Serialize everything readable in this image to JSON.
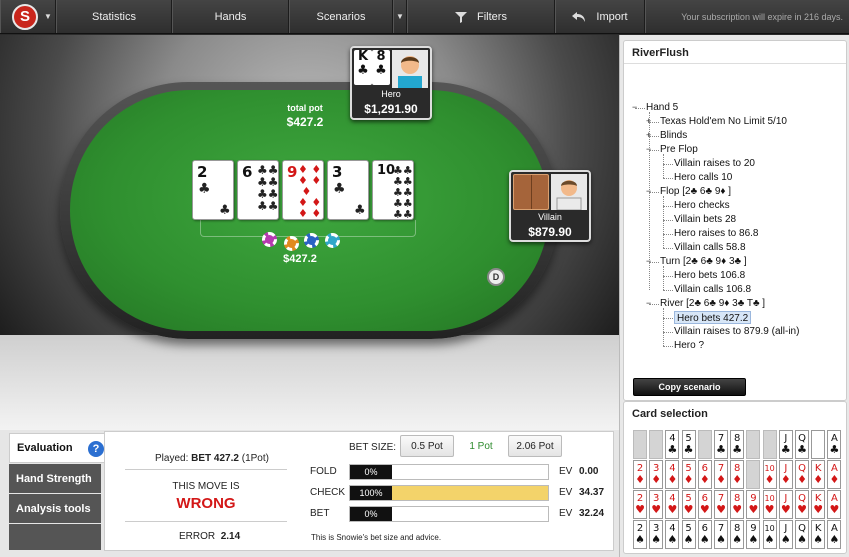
{
  "topbar": {
    "tabs": [
      "Statistics",
      "Hands",
      "Scenarios",
      "Filters",
      "Import"
    ],
    "logo_letter": "S",
    "subscription": "Your subscription will expire in 216 days."
  },
  "table": {
    "total_pot_label": "total pot",
    "total_pot": "$427.2",
    "pot_bet": "$427.2",
    "board": [
      {
        "rank": "2",
        "suit": "♣",
        "red": false
      },
      {
        "rank": "6",
        "suit": "♣",
        "red": false
      },
      {
        "rank": "9",
        "suit": "♦",
        "red": true
      },
      {
        "rank": "3",
        "suit": "♣",
        "red": false
      },
      {
        "rank": "10",
        "suit": "♣",
        "red": false
      }
    ],
    "hero": {
      "name": "Hero",
      "stack": "$1,291.90",
      "cards": [
        {
          "rank": "K",
          "suit": "♣"
        },
        {
          "rank": "8",
          "suit": "♣"
        }
      ]
    },
    "villain": {
      "name": "Villain",
      "stack": "$879.90"
    },
    "dealer_label": "D"
  },
  "scenario": {
    "title": "RiverFlush",
    "tree": [
      {
        "text": "Hand 5",
        "level": 0,
        "toggle": "−"
      },
      {
        "text": "Texas Hold'em No Limit 5/10",
        "level": 1,
        "toggle": "+"
      },
      {
        "text": "Blinds",
        "level": 1,
        "toggle": "+"
      },
      {
        "text": "Pre Flop",
        "level": 1,
        "toggle": "−"
      },
      {
        "text": "Villain raises to 20",
        "level": 2
      },
      {
        "text": "Hero calls 10",
        "level": 2
      },
      {
        "text": "Flop [2♣ 6♣ 9♦ ]",
        "level": 1,
        "toggle": "−"
      },
      {
        "text": "Hero checks",
        "level": 2
      },
      {
        "text": "Villain bets 28",
        "level": 2
      },
      {
        "text": "Hero raises to 86.8",
        "level": 2
      },
      {
        "text": "Villain calls 58.8",
        "level": 2
      },
      {
        "text": "Turn [2♣ 6♣ 9♦ 3♣ ]",
        "level": 1,
        "toggle": "−"
      },
      {
        "text": "Hero bets 106.8",
        "level": 2
      },
      {
        "text": "Villain calls 106.8",
        "level": 2
      },
      {
        "text": "River [2♣ 6♣ 9♦ 3♣ T♣ ]",
        "level": 1,
        "toggle": "−"
      },
      {
        "text": "Hero bets 427.2",
        "level": 2,
        "selected": true
      },
      {
        "text": "Villain raises to 879.9 (all-in)",
        "level": 2
      },
      {
        "text": "Hero ?",
        "level": 2
      }
    ],
    "copy_button": "Copy scenario"
  },
  "card_selection": {
    "title": "Card selection",
    "ranks": [
      "2",
      "3",
      "4",
      "5",
      "6",
      "7",
      "8",
      "9",
      "10",
      "J",
      "Q",
      "K",
      "A"
    ],
    "rows": [
      {
        "suit": "♣",
        "red": false,
        "used": [
          "2",
          "3",
          "6",
          "9",
          "10"
        ],
        "hidden": [
          "K"
        ]
      },
      {
        "suit": "♦",
        "red": true,
        "used": [
          "9"
        ]
      },
      {
        "suit": "♥",
        "red": true,
        "used": []
      },
      {
        "suit": "♠",
        "red": false,
        "used": []
      }
    ]
  },
  "evaluation": {
    "tabs": [
      "Evaluation",
      "Hand Strength",
      "Analysis tools"
    ],
    "help_icon": "?",
    "played_label": "Played:",
    "played_value": "BET 427.2",
    "played_extra": "(1Pot)",
    "move_label": "THIS MOVE IS",
    "move_verdict": "WRONG",
    "error_label": "ERROR",
    "error_value": "2.14",
    "bet_size_label": "BET SIZE:",
    "bet_sizes": [
      "0.5 Pot",
      "1 Pot",
      "2.06 Pot"
    ],
    "actions": [
      {
        "name": "FOLD",
        "pct": "0%",
        "fill": 0,
        "ev": "0.00"
      },
      {
        "name": "CHECK",
        "pct": "100%",
        "fill": 1,
        "ev": "34.37"
      },
      {
        "name": "BET",
        "pct": "0%",
        "fill": 0,
        "ev": "32.24"
      }
    ],
    "ev_label": "EV",
    "footer": "This is Snowie's bet size and advice."
  },
  "colors": {
    "felt": "#2f8f2f",
    "wrong": "#d31717",
    "check_bar": "#f3d36a",
    "logo": "#c9261c"
  }
}
